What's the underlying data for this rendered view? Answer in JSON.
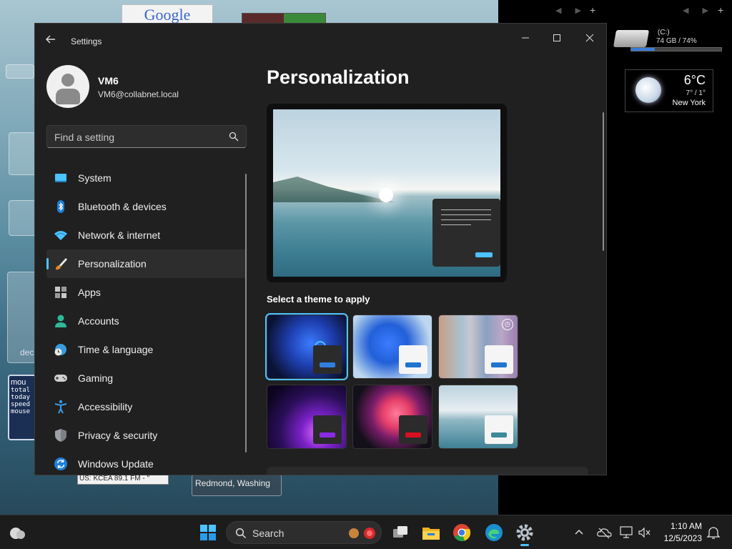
{
  "desktop": {
    "google_widget": "Google",
    "radio_widget": "US: KCEA 89.1 FM - \"",
    "weather_location_widget": "Redmond, Washing",
    "deco_label": "dec",
    "mouse_widget": {
      "title": "mou",
      "lines": [
        "total",
        "today",
        "speed",
        "mouse"
      ]
    },
    "drive": {
      "name": "(C:)",
      "usage": "74 GB / 74%",
      "used_fraction": 0.26
    },
    "weather": {
      "temp": "6°C",
      "range": "7° / 1°",
      "city": "New York"
    }
  },
  "window": {
    "title": "Settings",
    "controls": {
      "minimize": "—",
      "maximize": "☐",
      "close": "✕"
    }
  },
  "profile": {
    "name": "VM6",
    "email": "VM6@collabnet.local"
  },
  "search": {
    "placeholder": "Find a setting"
  },
  "nav": {
    "items": [
      {
        "label": "System",
        "icon": "system-icon"
      },
      {
        "label": "Bluetooth & devices",
        "icon": "bluetooth-icon"
      },
      {
        "label": "Network & internet",
        "icon": "network-icon"
      },
      {
        "label": "Personalization",
        "icon": "brush-icon",
        "active": true
      },
      {
        "label": "Apps",
        "icon": "apps-icon"
      },
      {
        "label": "Accounts",
        "icon": "accounts-icon"
      },
      {
        "label": "Time & language",
        "icon": "globe-clock-icon"
      },
      {
        "label": "Gaming",
        "icon": "gamepad-icon"
      },
      {
        "label": "Accessibility",
        "icon": "accessibility-icon"
      },
      {
        "label": "Privacy & security",
        "icon": "shield-icon"
      },
      {
        "label": "Windows Update",
        "icon": "update-icon"
      }
    ]
  },
  "main": {
    "title": "Personalization",
    "themes_label": "Select a theme to apply",
    "accent": "#4cc2ff"
  },
  "taskbar": {
    "search_label": "Search",
    "time": "1:10 AM",
    "date": "12/5/2023"
  }
}
